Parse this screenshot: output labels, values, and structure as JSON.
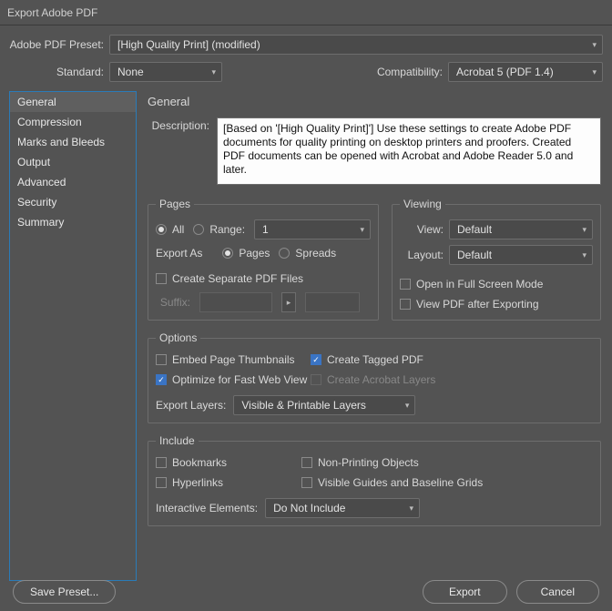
{
  "window": {
    "title": "Export Adobe PDF"
  },
  "preset": {
    "label": "Adobe PDF Preset:",
    "value": "[High Quality Print] (modified)"
  },
  "standard": {
    "label": "Standard:",
    "value": "None"
  },
  "compatibility": {
    "label": "Compatibility:",
    "value": "Acrobat 5 (PDF 1.4)"
  },
  "sidebar": {
    "items": [
      {
        "label": "General"
      },
      {
        "label": "Compression"
      },
      {
        "label": "Marks and Bleeds"
      },
      {
        "label": "Output"
      },
      {
        "label": "Advanced"
      },
      {
        "label": "Security"
      },
      {
        "label": "Summary"
      }
    ],
    "selected_index": 0
  },
  "general": {
    "title": "General",
    "description_label": "Description:",
    "description": "[Based on '[High Quality Print]'] Use these settings to create Adobe PDF documents for quality printing on desktop printers and proofers. Created PDF documents can be opened with Acrobat and Adobe Reader 5.0 and later.",
    "pages": {
      "legend": "Pages",
      "all": "All",
      "range_label": "Range:",
      "range_value": "1",
      "export_as": "Export As",
      "pages_option": "Pages",
      "spreads_option": "Spreads",
      "create_separate": "Create Separate PDF Files",
      "suffix_label": "Suffix:"
    },
    "viewing": {
      "legend": "Viewing",
      "view_label": "View:",
      "view_value": "Default",
      "layout_label": "Layout:",
      "layout_value": "Default",
      "fullscreen": "Open in Full Screen Mode",
      "view_after": "View PDF after Exporting"
    },
    "options": {
      "legend": "Options",
      "embed_thumbs": "Embed Page Thumbnails",
      "create_tagged": "Create Tagged PDF",
      "optimize": "Optimize for Fast Web View",
      "acrobat_layers": "Create Acrobat Layers",
      "export_layers_label": "Export Layers:",
      "export_layers_value": "Visible & Printable Layers"
    },
    "include": {
      "legend": "Include",
      "bookmarks": "Bookmarks",
      "nonprinting": "Non-Printing Objects",
      "hyperlinks": "Hyperlinks",
      "visibleguides": "Visible Guides and Baseline Grids",
      "interactive_label": "Interactive Elements:",
      "interactive_value": "Do Not Include"
    }
  },
  "footer": {
    "save_preset": "Save Preset...",
    "export": "Export",
    "cancel": "Cancel"
  }
}
